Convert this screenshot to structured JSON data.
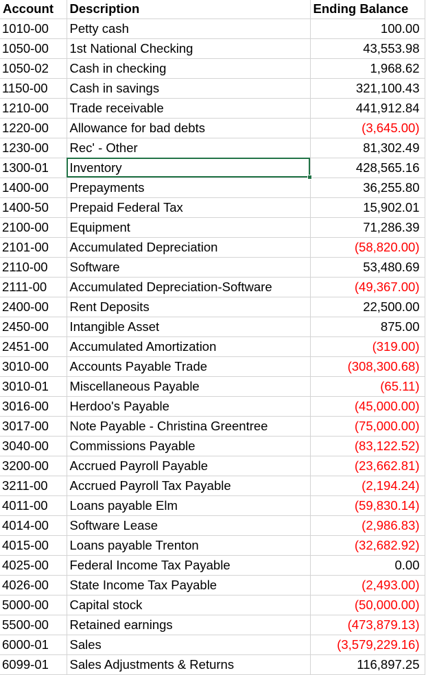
{
  "headers": {
    "account": "Account",
    "description": "Description",
    "balance": "Ending Balance"
  },
  "selected_row": 7,
  "rows": [
    {
      "account": "1010-00",
      "description": "Petty cash",
      "balance": "100.00",
      "negative": false
    },
    {
      "account": "1050-00",
      "description": "1st National Checking",
      "balance": "43,553.98",
      "negative": false
    },
    {
      "account": "1050-02",
      "description": "Cash in checking",
      "balance": "1,968.62",
      "negative": false
    },
    {
      "account": "1150-00",
      "description": "Cash in savings",
      "balance": "321,100.43",
      "negative": false
    },
    {
      "account": "1210-00",
      "description": "Trade receivable",
      "balance": "441,912.84",
      "negative": false
    },
    {
      "account": "1220-00",
      "description": "Allowance for bad debts",
      "balance": "(3,645.00)",
      "negative": true
    },
    {
      "account": "1230-00",
      "description": "Rec' - Other",
      "balance": "81,302.49",
      "negative": false
    },
    {
      "account": "1300-01",
      "description": "Inventory",
      "balance": "428,565.16",
      "negative": false
    },
    {
      "account": "1400-00",
      "description": "Prepayments",
      "balance": "36,255.80",
      "negative": false
    },
    {
      "account": "1400-50",
      "description": "Prepaid Federal Tax",
      "balance": "15,902.01",
      "negative": false
    },
    {
      "account": "2100-00",
      "description": "Equipment",
      "balance": "71,286.39",
      "negative": false
    },
    {
      "account": "2101-00",
      "description": "Accumulated Depreciation",
      "balance": "(58,820.00)",
      "negative": true
    },
    {
      "account": "2110-00",
      "description": "Software",
      "balance": "53,480.69",
      "negative": false
    },
    {
      "account": "2111-00",
      "description": "Accumulated Depreciation-Software",
      "balance": "(49,367.00)",
      "negative": true
    },
    {
      "account": "2400-00",
      "description": "Rent Deposits",
      "balance": "22,500.00",
      "negative": false
    },
    {
      "account": "2450-00",
      "description": "Intangible Asset",
      "balance": "875.00",
      "negative": false
    },
    {
      "account": "2451-00",
      "description": "Accumulated Amortization",
      "balance": "(319.00)",
      "negative": true
    },
    {
      "account": "3010-00",
      "description": "Accounts Payable Trade",
      "balance": "(308,300.68)",
      "negative": true
    },
    {
      "account": "3010-01",
      "description": "Miscellaneous Payable",
      "balance": "(65.11)",
      "negative": true
    },
    {
      "account": "3016-00",
      "description": "Herdoo's Payable",
      "balance": "(45,000.00)",
      "negative": true
    },
    {
      "account": "3017-00",
      "description": "Note Payable - Christina Greentree",
      "balance": "(75,000.00)",
      "negative": true
    },
    {
      "account": "3040-00",
      "description": "Commissions Payable",
      "balance": "(83,122.52)",
      "negative": true
    },
    {
      "account": "3200-00",
      "description": "Accrued Payroll Payable",
      "balance": "(23,662.81)",
      "negative": true
    },
    {
      "account": "3211-00",
      "description": "Accrued Payroll Tax Payable",
      "balance": "(2,194.24)",
      "negative": true
    },
    {
      "account": "4011-00",
      "description": "Loans payable Elm",
      "balance": "(59,830.14)",
      "negative": true
    },
    {
      "account": "4014-00",
      "description": "Software Lease",
      "balance": "(2,986.83)",
      "negative": true
    },
    {
      "account": "4015-00",
      "description": "Loans payable Trenton",
      "balance": "(32,682.92)",
      "negative": true
    },
    {
      "account": "4025-00",
      "description": "Federal Income Tax Payable",
      "balance": "0.00",
      "negative": false
    },
    {
      "account": "4026-00",
      "description": "State Income Tax Payable",
      "balance": "(2,493.00)",
      "negative": true
    },
    {
      "account": "5000-00",
      "description": "Capital stock",
      "balance": "(50,000.00)",
      "negative": true
    },
    {
      "account": "5500-00",
      "description": "Retained earnings",
      "balance": "(473,879.13)",
      "negative": true
    },
    {
      "account": "6000-01",
      "description": "Sales",
      "balance": "(3,579,229.16)",
      "negative": true
    },
    {
      "account": "6099-01",
      "description": "Sales Adjustments & Returns",
      "balance": "116,897.25",
      "negative": false
    }
  ],
  "colors": {
    "negative": "#ff0000",
    "selection": "#217346",
    "gridline": "#d4d4d4"
  }
}
